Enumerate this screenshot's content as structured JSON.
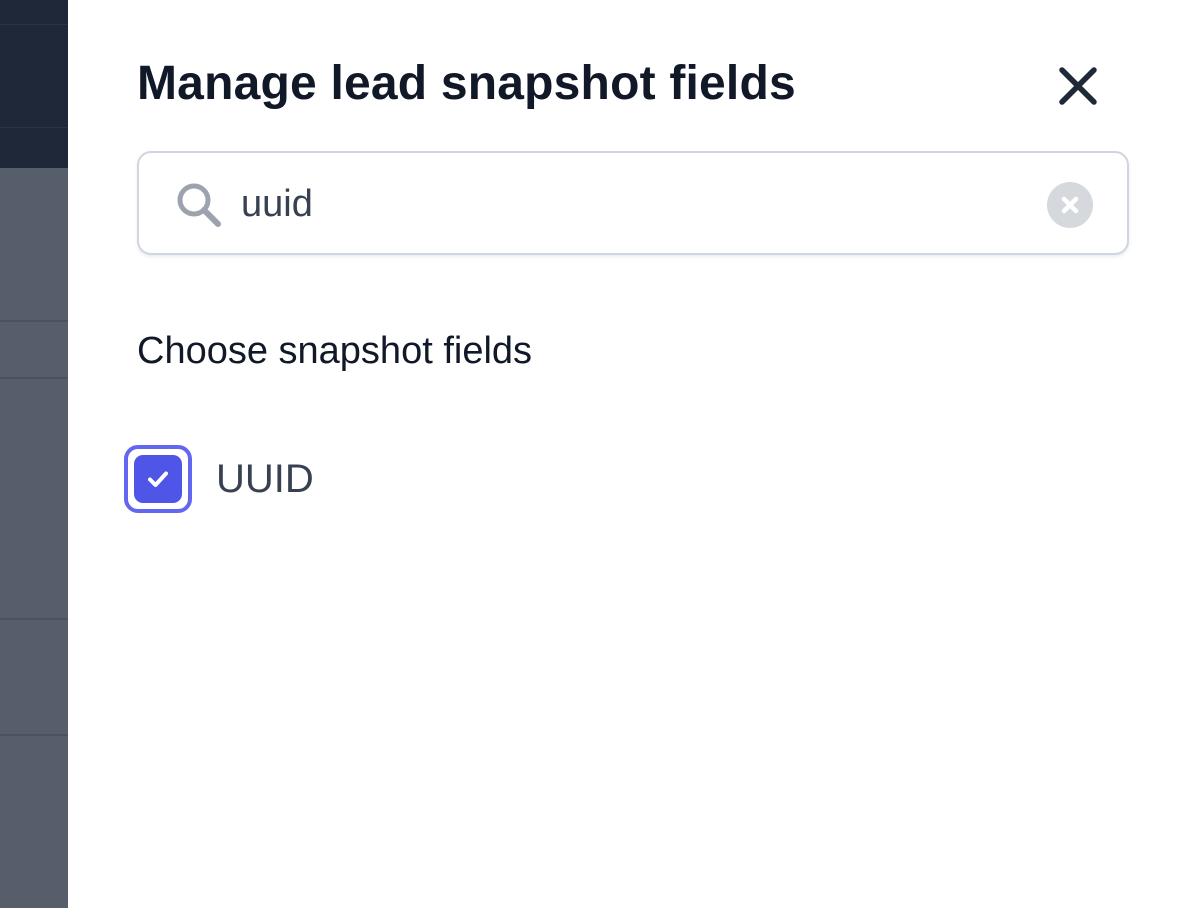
{
  "drawer": {
    "title": "Manage lead snapshot fields",
    "close_icon": "close-icon"
  },
  "search": {
    "value": "uuid",
    "placeholder": "",
    "icon": "search-icon",
    "clear_icon": "clear-circle-icon"
  },
  "fields_section": {
    "heading": "Choose snapshot fields",
    "items": [
      {
        "label": "UUID",
        "checked": true
      }
    ]
  },
  "colors": {
    "accent": "#4f55e6",
    "focus_ring": "#6366f1",
    "title_text": "#111827",
    "backdrop": "#565d6b"
  }
}
